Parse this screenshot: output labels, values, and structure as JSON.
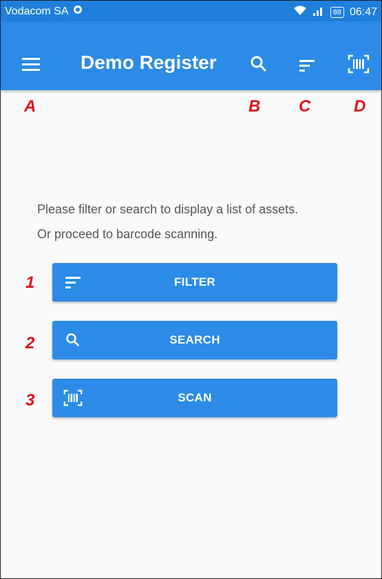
{
  "status_bar": {
    "carrier": "Vodacom SA",
    "battery": "88",
    "time": "06:47"
  },
  "app_bar": {
    "title": "Demo Register",
    "icons": [
      "menu-icon",
      "search-icon",
      "filter-icon",
      "barcode-scan-icon"
    ],
    "color": "#2b8be6"
  },
  "annotations": {
    "menu": "A",
    "search": "B",
    "filter": "C",
    "scan": "D",
    "filter_button": "1",
    "search_button": "2",
    "scan_button": "3"
  },
  "message": {
    "line1": "Please filter or search to display a list of assets.",
    "line2": "Or proceed to barcode scanning."
  },
  "buttons": {
    "filter": "FILTER",
    "search": "SEARCH",
    "scan": "SCAN"
  }
}
